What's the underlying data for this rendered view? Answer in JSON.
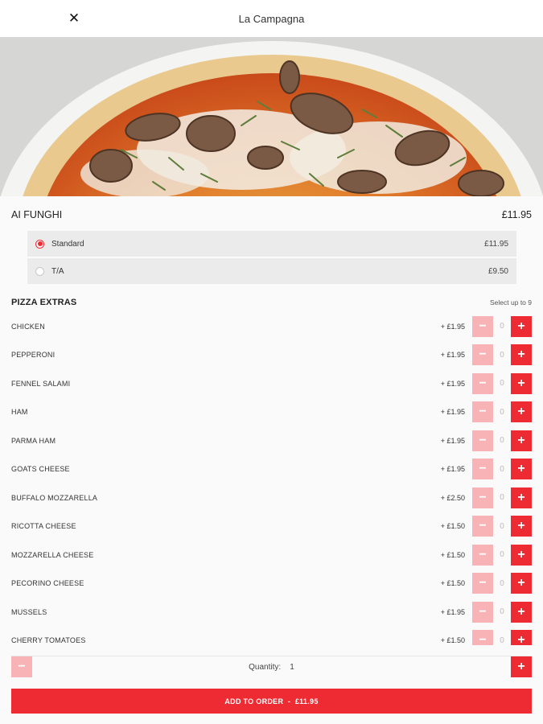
{
  "header": {
    "title": "La Campagna",
    "close_icon": "close-icon"
  },
  "item": {
    "name": "AI FUNGHI",
    "price": "£11.95"
  },
  "variants": [
    {
      "label": "Standard",
      "price": "£11.95",
      "selected": true
    },
    {
      "label": "T/A",
      "price": "£9.50",
      "selected": false
    }
  ],
  "extras": {
    "title": "PIZZA EXTRAS",
    "note": "Select up to 9",
    "items": [
      {
        "name": "CHICKEN",
        "price": "+ £1.95",
        "qty": "0"
      },
      {
        "name": "PEPPERONI",
        "price": "+ £1.95",
        "qty": "0"
      },
      {
        "name": "FENNEL SALAMI",
        "price": "+ £1.95",
        "qty": "0"
      },
      {
        "name": "HAM",
        "price": "+ £1.95",
        "qty": "0"
      },
      {
        "name": "PARMA HAM",
        "price": "+ £1.95",
        "qty": "0"
      },
      {
        "name": "GOATS CHEESE",
        "price": "+ £1.95",
        "qty": "0"
      },
      {
        "name": "BUFFALO MOZZARELLA",
        "price": "+ £2.50",
        "qty": "0"
      },
      {
        "name": "RICOTTA CHEESE",
        "price": "+ £1.50",
        "qty": "0"
      },
      {
        "name": "MOZZARELLA CHEESE",
        "price": "+ £1.50",
        "qty": "0"
      },
      {
        "name": "PECORINO CHEESE",
        "price": "+ £1.50",
        "qty": "0"
      },
      {
        "name": "MUSSELS",
        "price": "+ £1.95",
        "qty": "0"
      },
      {
        "name": "CHERRY TOMATOES",
        "price": "+ £1.50",
        "qty": "0"
      }
    ]
  },
  "stepper": {
    "minus": "−",
    "plus": "+"
  },
  "quantity": {
    "label": "Quantity:",
    "value": "1"
  },
  "add_button": {
    "label": "ADD TO ORDER",
    "separator": "-",
    "total": "£11.95"
  },
  "colors": {
    "accent": "#ee2a33",
    "accent_light": "#f7b3b6",
    "panel": "#ebebeb"
  }
}
